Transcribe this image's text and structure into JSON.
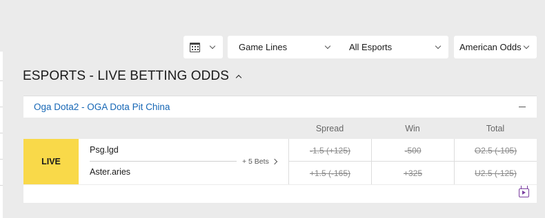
{
  "filters": {
    "calendar_icon": "calendar-icon",
    "market_label": "Game Lines",
    "sport_label": "All Esports",
    "odds_format_label": "American Odds"
  },
  "heading": "ESPORTS - LIVE BETTING ODDS",
  "league": {
    "title": "Oga Dota2 - OGA Dota Pit China"
  },
  "columns": {
    "spread": "Spread",
    "win": "Win",
    "total": "Total"
  },
  "event": {
    "status": "LIVE",
    "team1": "Psg.lgd",
    "team2": "Aster.aries",
    "more_bets": "+ 5 Bets",
    "odds": {
      "team1": {
        "spread": "-1.5 (+125)",
        "win": "-500",
        "total": "O2.5 (-105)"
      },
      "team2": {
        "spread": "+1.5 (-165)",
        "win": "+325",
        "total": "U2.5 (-125)"
      }
    }
  },
  "colors": {
    "live_badge": "#f9d949",
    "league_link": "#1566b5",
    "tv_icon": "#7b3fa0",
    "background": "#ebebeb"
  }
}
